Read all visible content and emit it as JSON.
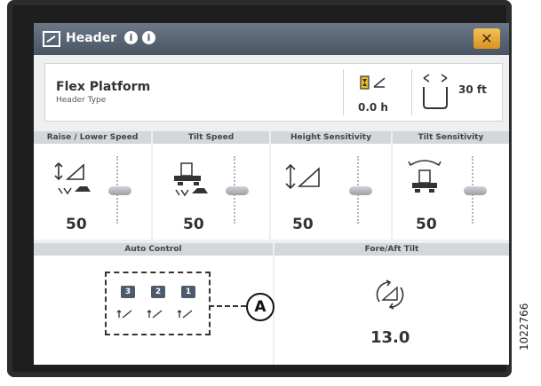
{
  "window": {
    "title": "Header",
    "close_label": "✕"
  },
  "header_info": {
    "name": "Flex Platform",
    "type_label": "Header Type",
    "hours": "0.0 h",
    "width": "30 ft"
  },
  "panels": [
    {
      "title": "Raise / Lower Speed",
      "value": "50"
    },
    {
      "title": "Tilt Speed",
      "value": "50"
    },
    {
      "title": "Height Sensitivity",
      "value": "50"
    },
    {
      "title": "Tilt Sensitivity",
      "value": "50"
    }
  ],
  "auto_control": {
    "title": "Auto Control",
    "modes": [
      "3",
      "2",
      "1"
    ],
    "callout": "A"
  },
  "fore_aft": {
    "title": "Fore/Aft Tilt",
    "value": "13.0"
  },
  "doc_number": "1022766",
  "colors": {
    "titlebar": "#4a5563",
    "close": "#e3a233",
    "panel_header": "#d3d6db"
  }
}
